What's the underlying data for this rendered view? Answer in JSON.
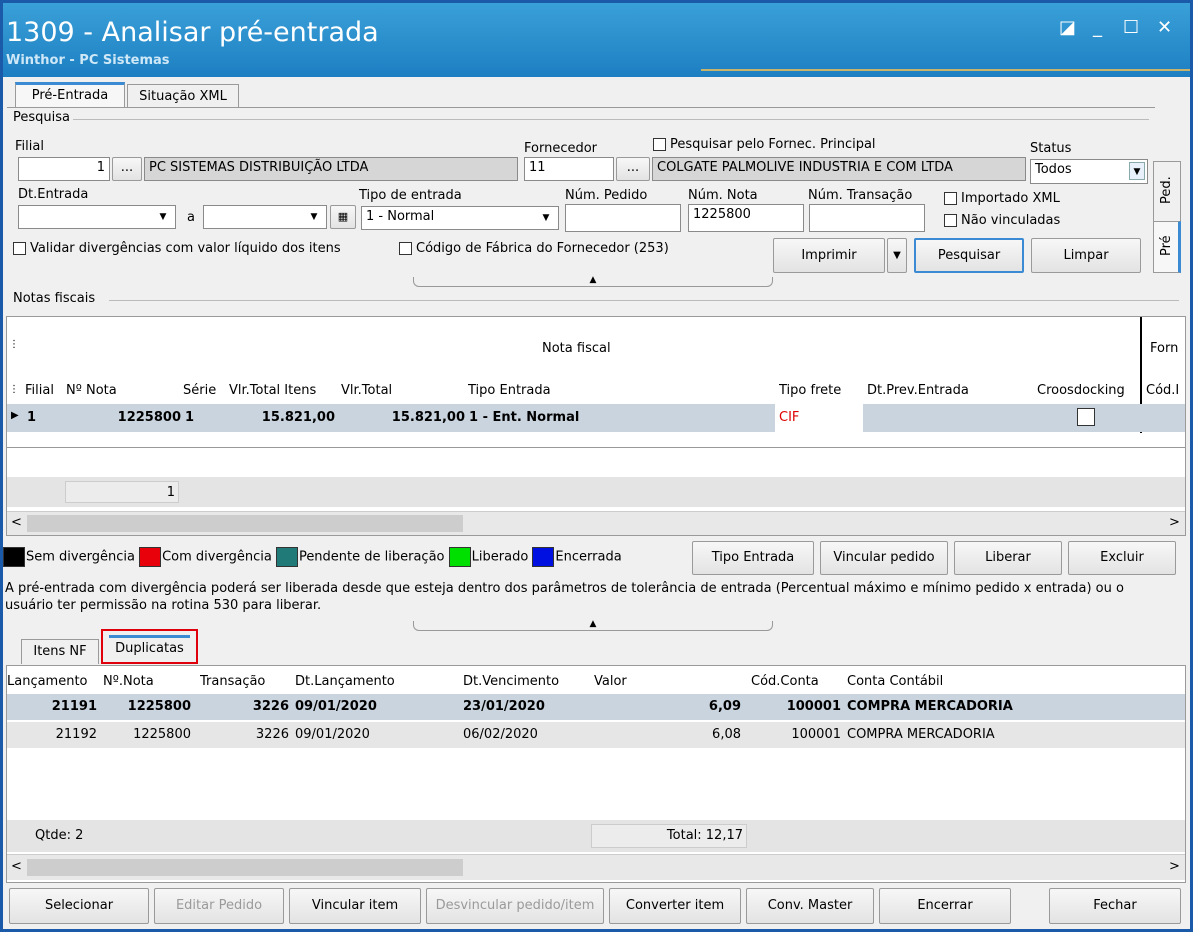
{
  "window": {
    "title": "1309 - Analisar pré-entrada",
    "subtitle": "Winthor - PC Sistemas",
    "controls": [
      "◪",
      "_",
      "☐",
      "✕"
    ]
  },
  "top_tabs": [
    "Pré-Entrada",
    "Situação XML"
  ],
  "side_tabs": [
    "Ped.",
    "Pré"
  ],
  "pesquisa": {
    "group_label": "Pesquisa",
    "filial_label": "Filial",
    "filial_value": "1",
    "filial_name": "PC SISTEMAS DISTRIBUIÇÃO LTDA",
    "fornecedor_label": "Fornecedor",
    "fornecedor_value": "11",
    "fornecedor_name": "COLGATE PALMOLIVE INDUSTRIA  E COM LTDA",
    "pesq_fornec_label": "Pesquisar pelo Fornec. Principal",
    "status_label": "Status",
    "status_value": "Todos",
    "dt_entrada_label": "Dt.Entrada",
    "a_label": "a",
    "tipo_entrada_label": "Tipo de entrada",
    "tipo_entrada_value": "1 - Normal",
    "num_pedido_label": "Núm. Pedido",
    "num_pedido_value": "",
    "num_nota_label": "Núm. Nota",
    "num_nota_value": "1225800",
    "num_transacao_label": "Núm. Transação",
    "num_transacao_value": "",
    "importado_xml_label": "Importado XML",
    "nao_vinculadas_label": "Não vinculadas",
    "validar_label": "Validar divergências com valor líquido dos itens",
    "codigo_fabrica_label": "Código de Fábrica do Fornecedor (253)",
    "imprimir": "Imprimir",
    "pesquisar": "Pesquisar",
    "limpar": "Limpar",
    "browse": "...",
    "calendar_icon": "calendar-icon"
  },
  "notas": {
    "group_label": "Notas fiscais",
    "band_label": "Nota fiscal",
    "band_label2": "Forn",
    "columns": [
      "Filial",
      "Nº Nota",
      "Série",
      "Vlr.Total Itens",
      "Vlr.Total",
      "Tipo Entrada",
      "Tipo frete",
      "Dt.Prev.Entrada",
      "Croosdocking",
      "Cód.I"
    ],
    "rows": [
      {
        "filial": "1",
        "nota": "1225800",
        "serie": "1",
        "vlr_itens": "15.821,00",
        "vlr_total": "15.821,00",
        "tipo": "1 - Ent. Normal",
        "frete": "CIF",
        "dt_prev": "",
        "cross": ""
      }
    ],
    "footer_count": "1",
    "frete_color": "#e00000"
  },
  "legend": [
    {
      "label": "Sem divergência",
      "color": "#000000"
    },
    {
      "label": "Com divergência",
      "color": "#e8000b"
    },
    {
      "label": "Pendente de liberação",
      "color": "#1f7a78"
    },
    {
      "label": "Liberado",
      "color": "#00e000"
    },
    {
      "label": "Encerrada",
      "color": "#0010e0"
    }
  ],
  "actions1": [
    "Tipo Entrada",
    "Vincular pedido",
    "Liberar",
    "Excluir"
  ],
  "info_text": "A pré-entrada com divergência poderá ser liberada desde que esteja dentro dos parâmetros de tolerância de entrada (Percentual máximo e mínimo pedido x entrada) ou o usuário ter permissão na rotina 530 para liberar.",
  "bottom_tabs": [
    "Itens NF",
    "Duplicatas"
  ],
  "duplicatas": {
    "columns": [
      "Lançamento",
      "Nº.Nota",
      "Transação",
      "Dt.Lançamento",
      "Dt.Vencimento",
      "Valor",
      "Cód.Conta",
      "Conta Contábil"
    ],
    "rows": [
      {
        "lanc": "21191",
        "nota": "1225800",
        "trans": "3226",
        "dt_lanc": "09/01/2020",
        "dt_venc": "23/01/2020",
        "valor": "6,09",
        "cod": "100001",
        "conta": "COMPRA MERCADORIA"
      },
      {
        "lanc": "21192",
        "nota": "1225800",
        "trans": "3226",
        "dt_lanc": "09/01/2020",
        "dt_venc": "06/02/2020",
        "valor": "6,08",
        "cod": "100001",
        "conta": "COMPRA MERCADORIA"
      }
    ],
    "qtde": "Qtde: 2",
    "total": "Total: 12,17"
  },
  "actions2": [
    "Selecionar",
    "Editar Pedido",
    "Vincular item",
    "Desvincular pedido/item",
    "Converter item",
    "Conv. Master",
    "Encerrar",
    "Fechar"
  ]
}
